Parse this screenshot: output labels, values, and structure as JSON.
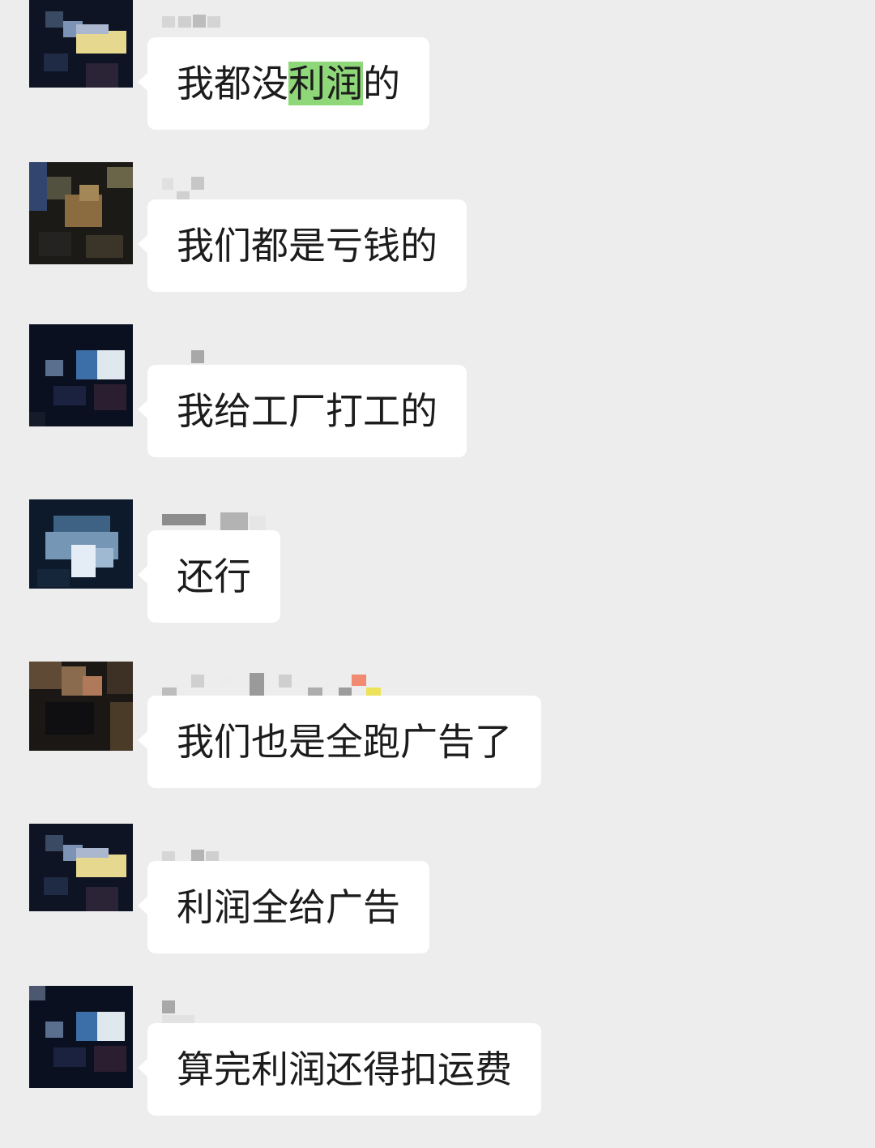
{
  "messages": [
    {
      "id": "m1",
      "avatar": "pixelated-avatar-a",
      "segments": [
        "我都没",
        "利润",
        "的"
      ],
      "highlight_index": 1
    },
    {
      "id": "m2",
      "avatar": "pixelated-avatar-b",
      "text": "我们都是亏钱的"
    },
    {
      "id": "m3",
      "avatar": "pixelated-avatar-c",
      "text": "我给工厂打工的"
    },
    {
      "id": "m4",
      "avatar": "pixelated-avatar-d",
      "text": "还行"
    },
    {
      "id": "m5",
      "avatar": "pixelated-avatar-e",
      "text": "我们也是全跑广告了"
    },
    {
      "id": "m6",
      "avatar": "pixelated-avatar-a",
      "text": "利润全给广告"
    },
    {
      "id": "m7",
      "avatar": "pixelated-avatar-c",
      "text": "算完利润还得扣运费"
    }
  ],
  "colors": {
    "background": "#ededed",
    "bubble": "#ffffff",
    "text": "#1c1c1c",
    "search_highlight": "#8fd879"
  }
}
